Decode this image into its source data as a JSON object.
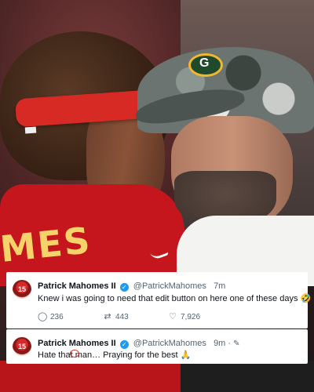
{
  "photo": {
    "jersey_text": "MES",
    "cap_logo": "G"
  },
  "tweets": [
    {
      "avatar_text": "15",
      "display_name": "Patrick Mahomes II",
      "handle": "@PatrickMahomes",
      "time": "7m",
      "edited": false,
      "text": "Knew i was going to need that edit button on here one of these days 🤣",
      "replies": "236",
      "retweets": "443",
      "likes": "7,926",
      "icons": {
        "reply": "reply-icon",
        "retweet": "retweet-icon",
        "like": "heart-icon",
        "verified": "verified-badge-icon"
      }
    },
    {
      "avatar_text": "15",
      "display_name": "Patrick Mahomes II",
      "handle": "@PatrickMahomes",
      "time": "9m",
      "separator": "·",
      "edited": true,
      "text": "Hate that man… Praying for the best 🙏",
      "icons": {
        "edit": "edit-pencil-icon",
        "verified": "verified-badge-icon"
      }
    }
  ],
  "colors": {
    "twitter_blue": "#1d9bf0",
    "chiefs_red": "#c4161c",
    "annotation_red": "#e0241b"
  }
}
